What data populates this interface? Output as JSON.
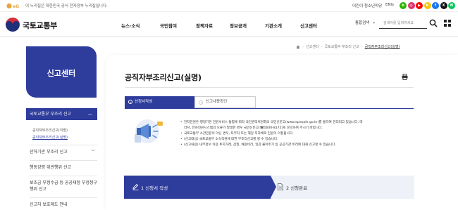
{
  "top_bar": {
    "gov_notice": "이 누리집은 대한민국 공식 전자정부 누리집입니다.",
    "kids_link": "어린이 청소년마당",
    "eng_link": "ENG",
    "social": [
      {
        "name": "blog",
        "color": "#2db400",
        "glyph": "b"
      },
      {
        "name": "instagram",
        "color": "#e1306c",
        "glyph": "◎"
      },
      {
        "name": "youtube",
        "color": "#ff0000",
        "glyph": "▶"
      },
      {
        "name": "kakao",
        "color": "#f7c600",
        "glyph": "K"
      },
      {
        "name": "facebook",
        "color": "#1877f2",
        "glyph": "f"
      },
      {
        "name": "x",
        "color": "#111111",
        "glyph": "X"
      },
      {
        "name": "naver",
        "color": "#03c75a",
        "glyph": "N"
      }
    ]
  },
  "header": {
    "logo_text": "국토교통부",
    "menu": [
      "뉴스·소식",
      "국민참여",
      "정책자료",
      "정보공개",
      "기관소개",
      "신고센터"
    ],
    "search_category": "통합검색",
    "search_placeholder": "검색어를 입력하세요"
  },
  "breadcrumb": {
    "items": [
      "신고센터",
      "국토교통부 부조리 신고",
      "공직자부조리신고(실명)"
    ]
  },
  "sidebar": {
    "title": "신고센터",
    "active_group": "국토교통부 부조리 신고",
    "sub_items": [
      "공직자부조리신고(익명)",
      "공직자부조리신고(실명)"
    ],
    "items": [
      {
        "label": "산하기관 부조리 신고",
        "has_toggle": true
      },
      {
        "label": "행동강령 위반행위 신고",
        "has_toggle": false
      },
      {
        "label": "보조금 부정수급 등 공공재정 부정청구행위 신고",
        "has_toggle": false
      },
      {
        "label": "신고자 보호제도 안내",
        "has_toggle": false
      }
    ]
  },
  "main": {
    "page_title": "공직자부조리신고(실명)",
    "tabs": [
      "신청서작성",
      "신고내용확인"
    ],
    "notice_lines": [
      "전자민원은 행정기관 민원서비스 통합에 따라 국민권익위원회의 국민신문고(www.epeople.go.kr)를 통하여 관리되고 있습니다. 따",
      "라서, 전자민원시스템의 오류가 발생한 경우 국민신문고(☎1600-8172)로 문의하여 주시기 바랍니다.",
      "국토교통부 소관민원이 아닌 경우, 타부처 또는 해당 지자체로 민원이 이첩됩니다.",
      "(신고대상) 국토교통부 소속직원에 대한 부조리신고를 할 수 있습니다.",
      "(신고내용) 내부정보 이용 토지거래, 갑질, 채용비리, 일감 몰아주기 등 공공기관 비리에 대해 신고할 수 있습니다."
    ],
    "steps": [
      "1 신청서 작성",
      "2 신청완료"
    ]
  },
  "colors": {
    "brand": "#2e3c9c",
    "step_bg": "#eef2f8"
  }
}
